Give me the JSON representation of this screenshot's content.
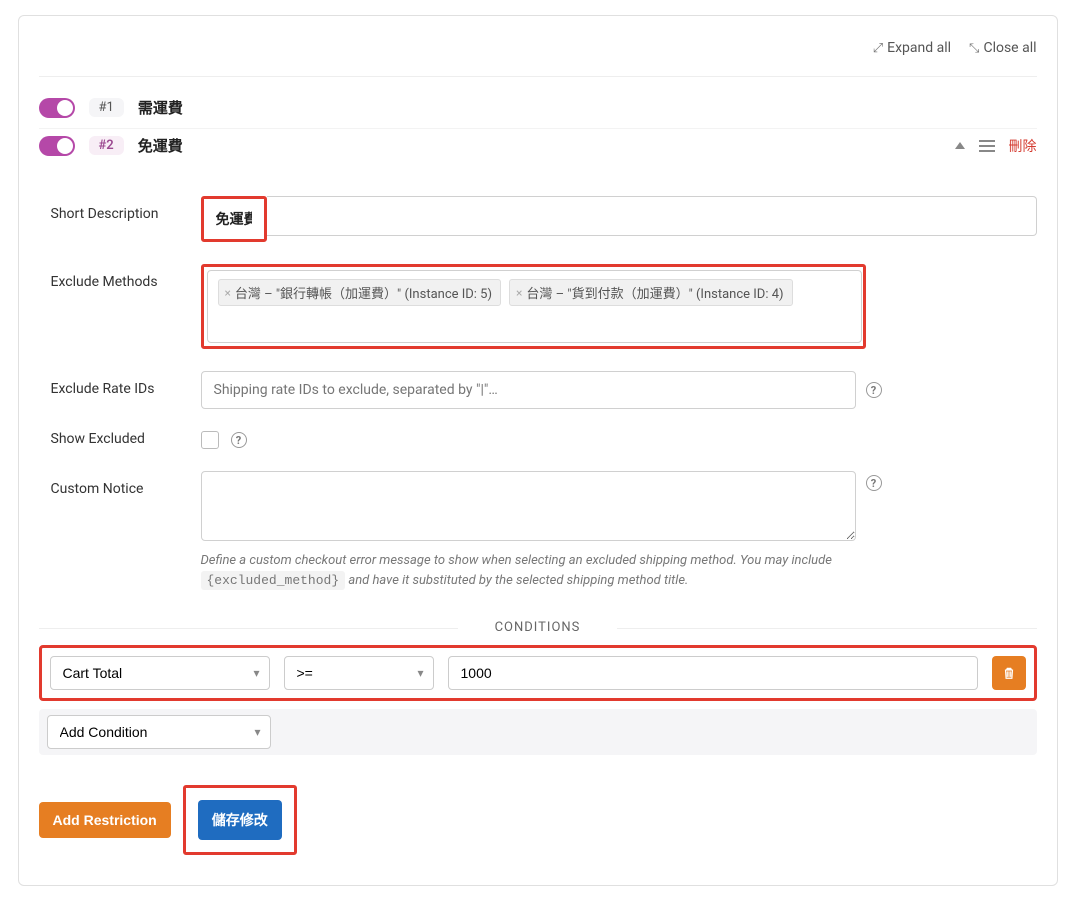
{
  "topActions": {
    "expandAll": "Expand all",
    "closeAll": "Close all"
  },
  "rules": [
    {
      "badge": "#1",
      "title": "需運費"
    },
    {
      "badge": "#2",
      "title": "免運費",
      "deleteLabel": "刪除"
    }
  ],
  "form": {
    "shortDescription": {
      "label": "Short Description",
      "value": "免運費"
    },
    "excludeMethods": {
      "label": "Exclude Methods",
      "tags": [
        "台灣 – \"銀行轉帳（加運費）\" (Instance ID: 5)",
        "台灣 – \"貨到付款（加運費）\" (Instance ID: 4)"
      ]
    },
    "excludeRateIds": {
      "label": "Exclude Rate IDs",
      "placeholder": "Shipping rate IDs to exclude, separated by \"|\"…"
    },
    "showExcluded": {
      "label": "Show Excluded"
    },
    "customNotice": {
      "label": "Custom Notice",
      "hint1": "Define a custom checkout error message to show when selecting an excluded shipping method. You may include",
      "code": "{excluded_method}",
      "hint2": " and have it substituted by the selected shipping method title."
    }
  },
  "conditions": {
    "header": "CONDITIONS",
    "row": {
      "field": "Cart Total",
      "op": ">=",
      "value": "1000"
    },
    "addLabel": "Add Condition"
  },
  "buttons": {
    "addRestriction": "Add Restriction",
    "save": "儲存修改"
  }
}
